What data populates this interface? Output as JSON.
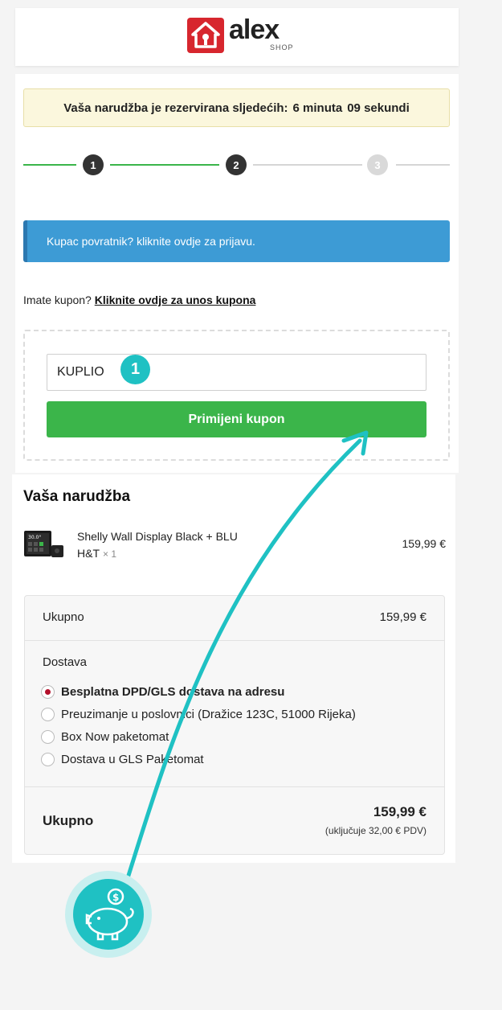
{
  "brand": {
    "name": "alex",
    "sub": "SHOP",
    "color": "#d7262e"
  },
  "timer": {
    "prefix": "Vaša narudžba je rezervirana sljedećih:",
    "minutes": "6 minuta",
    "seconds": "09 sekundi"
  },
  "steps": [
    {
      "n": "1",
      "state": "done"
    },
    {
      "n": "2",
      "state": "current"
    },
    {
      "n": "3",
      "state": "pending"
    }
  ],
  "login_bar": {
    "text": "Kupac povratnik? kliknite ovdje za prijavu."
  },
  "coupon": {
    "prompt": "Imate kupon?",
    "link": "Kliknite ovdje za unos kupona",
    "input_value": "KUPLIO",
    "badge": "1",
    "apply_label": "Primijeni kupon"
  },
  "order": {
    "title": "Vaša narudžba",
    "product": {
      "name": "Shelly Wall Display Black + BLU H&T",
      "qty": "× 1",
      "price": "159,99 €"
    },
    "subtotal": {
      "label": "Ukupno",
      "value": "159,99 €"
    },
    "shipping": {
      "title": "Dostava",
      "options": [
        {
          "label": "Besplatna DPD/GLS dostava na adresu",
          "selected": true
        },
        {
          "label": "Preuzimanje u poslovnici (Dražice 123C, 51000 Rijeka)",
          "selected": false
        },
        {
          "label": "Box Now paketomat",
          "selected": false
        },
        {
          "label": "Dostava u GLS Paketomat",
          "selected": false
        }
      ]
    },
    "total": {
      "label": "Ukupno",
      "value": "159,99 €",
      "tax_note": "(uključuje 32,00 € PDV)"
    }
  },
  "colors": {
    "green": "#3bb54a",
    "blue": "#3d9bd5",
    "teal": "#1fc1c3",
    "timer_bg": "#fbf7dd",
    "radio_selected": "#b3102b"
  },
  "icons": [
    "house-logo-icon",
    "piggy-bank-icon",
    "arrow-icon"
  ]
}
